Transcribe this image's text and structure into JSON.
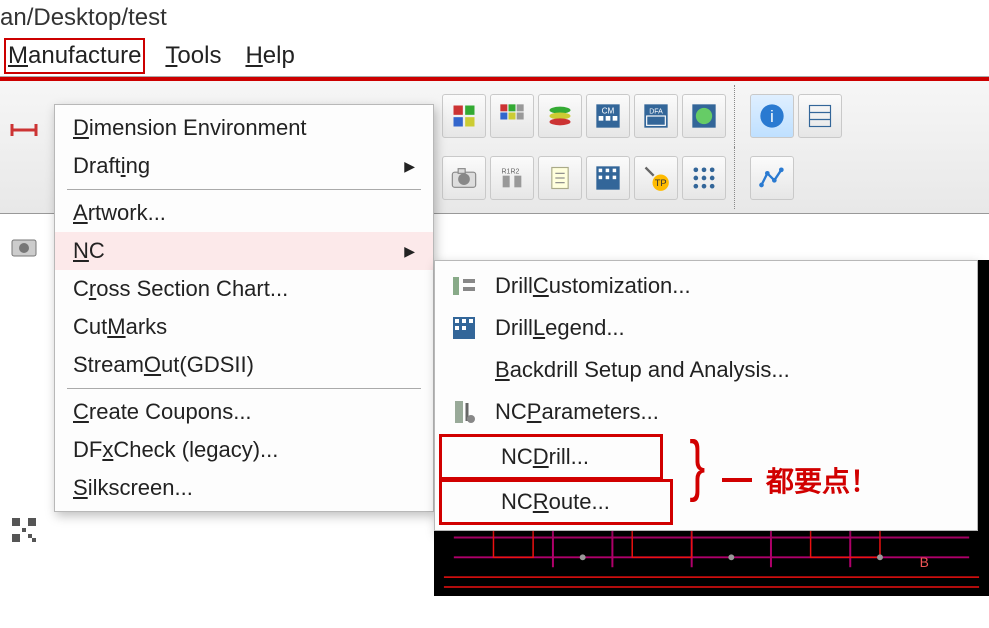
{
  "title_path": "an/Desktop/test",
  "menubar": {
    "manufacture": "Manufacture",
    "tools": "Tools",
    "help": "Help"
  },
  "dropdown": {
    "dimension_env": "Dimension Environment",
    "drafting": "Drafting",
    "artwork": "Artwork...",
    "nc": "NC",
    "cross_section": "Cross Section Chart...",
    "cut_marks": "Cut Marks",
    "stream_out": "Stream Out(GDSII)",
    "create_coupons": "Create Coupons...",
    "dfx_check": "DFx Check (legacy)...",
    "silkscreen": "Silkscreen..."
  },
  "submenu": {
    "drill_customization": "Drill Customization...",
    "drill_legend": "Drill Legend...",
    "backdrill": "Backdrill Setup and Analysis...",
    "nc_parameters": "NC Parameters...",
    "nc_drill": "NC Drill...",
    "nc_route": "NC Route..."
  },
  "annotation": "都要点！"
}
